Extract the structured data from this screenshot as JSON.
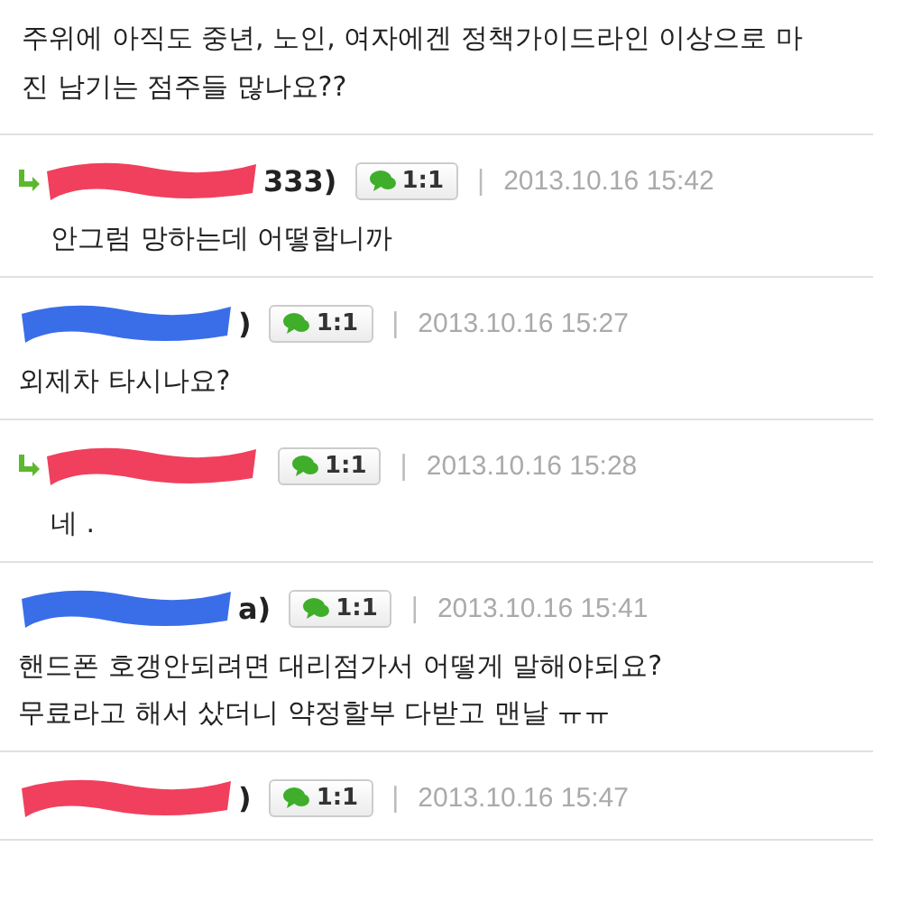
{
  "post": {
    "text": "주위에 아직도 중년, 노인, 여자에겐 정책가이드라인 이상으로 마진 남기는 점주들 많나요??"
  },
  "comments": [
    {
      "reply": true,
      "author": "333)",
      "color": "#f0405e",
      "chat_button": "1:1",
      "separator": "|",
      "date": "2013.10.16 15:42",
      "body": "안그럼 망하는데 어떻합니까"
    },
    {
      "reply": false,
      "author": ")",
      "color": "#3a6ee8",
      "chat_button": "1:1",
      "separator": "|",
      "date": "2013.10.16 15:27",
      "body": "외제차 타시나요?"
    },
    {
      "reply": true,
      "color": "#f0405e",
      "chat_button": "1:1",
      "separator": "|",
      "date": "2013.10.16 15:28",
      "body": "네 ."
    },
    {
      "reply": false,
      "author": "a)",
      "color": "#3a6ee8",
      "chat_button": "1:1",
      "separator": "|",
      "date": "2013.10.16 15:41",
      "body": "핸드폰 호갱안되려면 대리점가서 어떻게 말해야되요?\n무료라고 해서 샀더니 약정할부 다받고 맨날 ㅠㅠ"
    },
    {
      "reply": false,
      "author": ")",
      "color": "#f0405e",
      "chat_button": "1:1",
      "separator": "|",
      "date": "2013.10.16 15:47"
    }
  ]
}
